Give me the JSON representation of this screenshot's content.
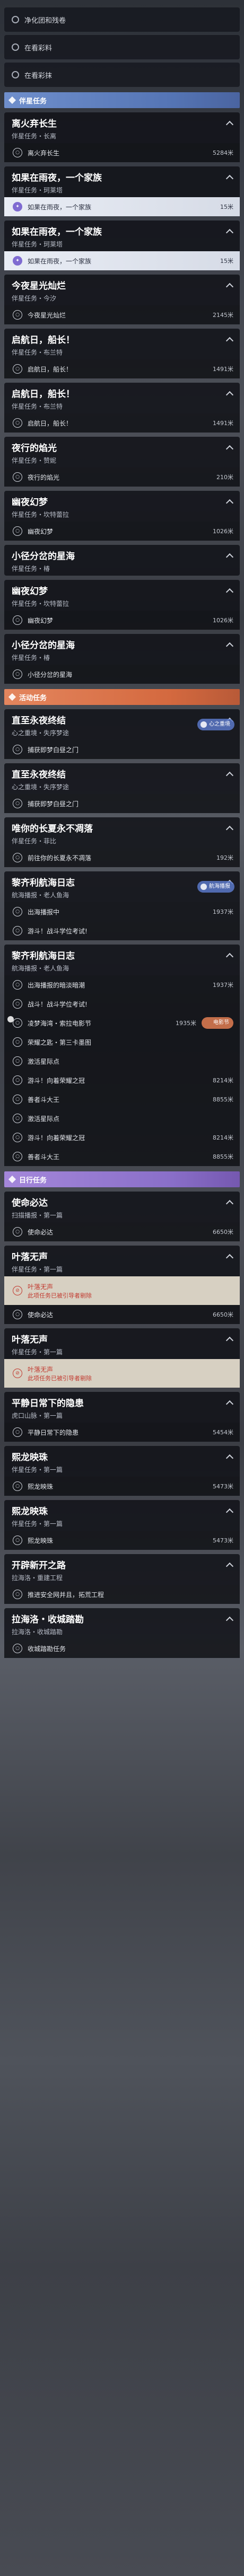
{
  "rows": [
    {
      "k": "plain",
      "t": "净化团和残卷"
    },
    {
      "k": "plain",
      "t": "在看彩料"
    },
    {
      "k": "plain",
      "t": "在看彩抹"
    },
    {
      "k": "section",
      "c": "blue",
      "t": "伴星任务"
    },
    {
      "k": "head",
      "t": "离火弃长生",
      "s": "伴星任务・长离",
      "open": true
    },
    {
      "k": "step",
      "t": "离火弃长生",
      "d": "5284米"
    },
    {
      "k": "head",
      "t": "如果在雨夜，一个家族",
      "s": "伴星任务・珂莱塔",
      "open": true
    },
    {
      "k": "step",
      "t": "如果在雨夜，一个家族",
      "d": "15米",
      "active": true
    },
    {
      "k": "head",
      "t": "如果在雨夜，一个家族",
      "s": "伴星任务・珂莱塔",
      "open": true
    },
    {
      "k": "step",
      "t": "如果在雨夜，一个家族",
      "d": "15米",
      "active": true
    },
    {
      "k": "head",
      "t": "今夜星光灿烂",
      "s": "伴星任务・今汐",
      "open": true
    },
    {
      "k": "step",
      "t": "今夜星光灿烂",
      "d": "2145米"
    },
    {
      "k": "head",
      "t": "启航日，船长！",
      "s": "伴星任务・布兰特",
      "open": true
    },
    {
      "k": "step",
      "t": "启航日，船长！",
      "d": "1491米"
    },
    {
      "k": "head",
      "t": "启航日，船长！",
      "s": "伴星任务・布兰特",
      "open": true
    },
    {
      "k": "step",
      "t": "启航日，船长！",
      "d": "1491米"
    },
    {
      "k": "head",
      "t": "夜行的焰光",
      "s": "伴星任务・赞妮",
      "open": true
    },
    {
      "k": "step",
      "t": "夜行的焰光",
      "d": "210米"
    },
    {
      "k": "head",
      "t": "幽夜幻梦",
      "s": "伴星任务・坎特蕾拉",
      "open": true
    },
    {
      "k": "step",
      "t": "幽夜幻梦",
      "d": "1026米"
    },
    {
      "k": "head",
      "t": "小径分岔的星海",
      "s": "伴星任务・椿",
      "open": false
    },
    {
      "k": "head",
      "t": "幽夜幻梦",
      "s": "伴星任务・坎特蕾拉",
      "open": true
    },
    {
      "k": "step",
      "t": "幽夜幻梦",
      "d": "1026米"
    },
    {
      "k": "head",
      "t": "小径分岔的星海",
      "s": "伴星任务・椿",
      "open": true
    },
    {
      "k": "step",
      "t": "小径分岔的星海",
      "d": ""
    },
    {
      "k": "section",
      "c": "orange",
      "t": "活动任务"
    },
    {
      "k": "head",
      "t": "直至永夜终结",
      "s": "心之重境・失序梦途",
      "open": true,
      "tag": "心之重境"
    },
    {
      "k": "step",
      "t": "捕获即梦白昼之门",
      "d": ""
    },
    {
      "k": "head",
      "t": "直至永夜终结",
      "s": "心之重境・失序梦途",
      "open": true
    },
    {
      "k": "step",
      "t": "捕获即梦白昼之门",
      "d": ""
    },
    {
      "k": "head",
      "t": "唯你的长夏永不凋落",
      "s": "伴星任务・菲比",
      "open": true
    },
    {
      "k": "step",
      "t": "前往你的长夏永不凋落",
      "d": "192米"
    },
    {
      "k": "head",
      "t": "黎齐利航海日志",
      "s": "航海播报・老人鱼海",
      "open": true,
      "tag": "航海播报"
    },
    {
      "k": "step",
      "t": "出海播报中",
      "d": "1937米"
    },
    {
      "k": "step",
      "t": "游斗！战斗学位考试!",
      "d": ""
    },
    {
      "k": "head",
      "t": "黎齐利航海日志",
      "s": "航海播报・老人鱼海",
      "open": true
    },
    {
      "k": "step",
      "t": "出海播报的暗淡暗潮",
      "d": "1937米"
    },
    {
      "k": "step",
      "t": "战斗！战斗学位考试!",
      "d": ""
    },
    {
      "k": "step",
      "t": "凌梦海湾・索拉电影节",
      "d": "1935米",
      "tag": "电影节"
    },
    {
      "k": "step",
      "t": "荣耀之匙・第三卡墨图",
      "d": ""
    },
    {
      "k": "step",
      "t": "激活星际点",
      "d": ""
    },
    {
      "k": "step",
      "t": "游斗！向着荣耀之冠",
      "d": "8214米"
    },
    {
      "k": "step",
      "t": "善者斗大王",
      "d": "8855米"
    },
    {
      "k": "step",
      "t": "激活星际点",
      "d": ""
    },
    {
      "k": "step",
      "t": "游斗！向着荣耀之冠",
      "d": "8214米"
    },
    {
      "k": "step",
      "t": "善者斗大王",
      "d": "8855米"
    },
    {
      "k": "section",
      "c": "purple",
      "t": "日行任务"
    },
    {
      "k": "head",
      "t": "使命必达",
      "s": "扫描播报・第一篇",
      "open": true
    },
    {
      "k": "step",
      "t": "使命必达",
      "d": "6650米"
    },
    {
      "k": "head",
      "t": "叶落无声",
      "s": "伴星任务・第一篇",
      "open": true
    },
    {
      "k": "step",
      "t": "叶落无声",
      "d": "",
      "err": true,
      "note": "此项任务已被引导者剔除"
    },
    {
      "k": "step",
      "t": "使命必达",
      "d": "6650米"
    },
    {
      "k": "head",
      "t": "叶落无声",
      "s": "伴星任务・第一篇",
      "open": true
    },
    {
      "k": "step",
      "t": "叶落无声",
      "d": "",
      "err": true,
      "note": "此项任务已被引导者剔除"
    },
    {
      "k": "head",
      "t": "平静日常下的隐患",
      "s": "虎口山脉・第一篇",
      "open": true
    },
    {
      "k": "step",
      "t": "平静日常下的隐患",
      "d": "5454米"
    },
    {
      "k": "head",
      "t": "熙龙映珠",
      "s": "伴星任务・第一篇",
      "open": true
    },
    {
      "k": "step",
      "t": "熙龙映珠",
      "d": "5473米"
    },
    {
      "k": "head",
      "t": "熙龙映珠",
      "s": "伴星任务・第一篇",
      "open": true
    },
    {
      "k": "step",
      "t": "熙龙映珠",
      "d": "5473米"
    },
    {
      "k": "head",
      "t": "开辟新开之路",
      "s": "拉海洛・重建工程",
      "open": true
    },
    {
      "k": "step",
      "t": "推进安全网并且，拓荒工程",
      "d": ""
    },
    {
      "k": "head",
      "t": "拉海洛・收城踏勘",
      "s": "拉海洛・收城踏勘",
      "open": true
    },
    {
      "k": "step",
      "t": "收城踏勘任务",
      "d": ""
    }
  ]
}
